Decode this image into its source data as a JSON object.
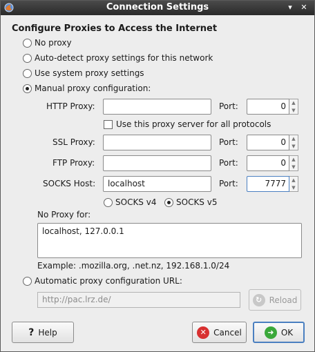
{
  "window": {
    "title": "Connection Settings"
  },
  "section_title": "Configure Proxies to Access the Internet",
  "proxy_modes": [
    {
      "label": "No proxy",
      "checked": false
    },
    {
      "label": "Auto-detect proxy settings for this network",
      "checked": false
    },
    {
      "label": "Use system proxy settings",
      "checked": false
    },
    {
      "label": "Manual proxy configuration:",
      "checked": true
    }
  ],
  "http": {
    "label": "HTTP Proxy:",
    "value": "",
    "port_label": "Port:",
    "port": "0"
  },
  "use_for_all": {
    "label": "Use this proxy server for all protocols",
    "checked": false
  },
  "ssl": {
    "label": "SSL Proxy:",
    "value": "",
    "port_label": "Port:",
    "port": "0"
  },
  "ftp": {
    "label": "FTP Proxy:",
    "value": "",
    "port_label": "Port:",
    "port": "0"
  },
  "socks": {
    "label": "SOCKS Host:",
    "value": "localhost",
    "port_label": "Port:",
    "port": "7777"
  },
  "socks_versions": [
    {
      "label": "SOCKS v4",
      "checked": false
    },
    {
      "label": "SOCKS v5",
      "checked": true
    }
  ],
  "no_proxy": {
    "label": "No Proxy for:",
    "value": "localhost, 127.0.0.1",
    "example": "Example: .mozilla.org, .net.nz, 192.168.1.0/24"
  },
  "auto_config": {
    "label": "Automatic proxy configuration URL:",
    "checked": false,
    "url": "http://pac.lrz.de/",
    "reload_label": "Reload"
  },
  "buttons": {
    "help": "Help",
    "cancel": "Cancel",
    "ok": "OK"
  },
  "colors": {
    "titlebar": "#2f2f2f",
    "cancel_icon": "#d83030",
    "ok_icon": "#3aa83a",
    "focus": "#4a7fc0"
  }
}
